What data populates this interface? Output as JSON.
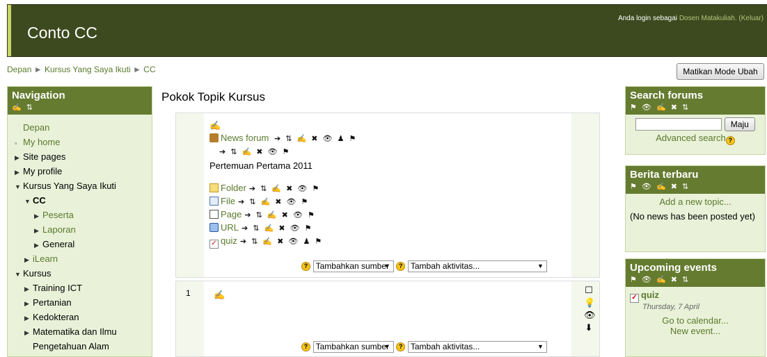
{
  "header": {
    "site_title": "Conto CC",
    "login_prefix": "Anda login sebagai",
    "login_user": "Dosen Matakuliah.",
    "logout_label": "(Keluar)"
  },
  "breadcrumb": {
    "items": [
      "Depan",
      "Kursus Yang Saya Ikuti",
      "CC"
    ],
    "separator": "►"
  },
  "edit_mode_button": "Matikan Mode Ubah",
  "navigation": {
    "title": "Navigation",
    "items": [
      {
        "label": "Depan",
        "marker": ""
      },
      {
        "label": "My home",
        "marker": "▫"
      },
      {
        "label": "Site pages",
        "marker": "▶"
      },
      {
        "label": "My profile",
        "marker": "▶"
      },
      {
        "label": "Kursus Yang Saya Ikuti",
        "marker": "▼"
      },
      {
        "label": "CC",
        "marker": "▼"
      },
      {
        "label": "Peserta",
        "marker": "▶"
      },
      {
        "label": "Laporan",
        "marker": "▶"
      },
      {
        "label": "General",
        "marker": "▶"
      },
      {
        "label": "iLearn",
        "marker": "▶"
      },
      {
        "label": "Kursus",
        "marker": "▼"
      },
      {
        "label": "Training ICT",
        "marker": "▶"
      },
      {
        "label": "Pertanian",
        "marker": "▶"
      },
      {
        "label": "Kedokteran",
        "marker": "▶"
      },
      {
        "label": "Matematika dan Ilmu",
        "marker": "▶"
      },
      {
        "label": "Pengetahuan Alam",
        "marker": ""
      }
    ]
  },
  "main": {
    "heading": "Pokok Topik Kursus",
    "section0": {
      "news_forum": "News forum",
      "summary": "Pertemuan Pertama 2011",
      "activities": [
        {
          "name": "Folder",
          "icon": "folder-icon"
        },
        {
          "name": "File",
          "icon": "file-icon"
        },
        {
          "name": "Page",
          "icon": "page-icon"
        },
        {
          "name": "URL",
          "icon": "url-icon"
        },
        {
          "name": "quiz",
          "icon": "quiz-icon"
        }
      ]
    },
    "section1": {
      "number": "1"
    },
    "add_resource": "Tambahkan sumber",
    "add_activity": "Tambah aktivitas..."
  },
  "search_forums": {
    "title": "Search forums",
    "go_label": "Maju",
    "advanced_search": "Advanced search"
  },
  "latest_news": {
    "title": "Berita terbaru",
    "add_topic": "Add a new topic...",
    "empty_text": "(No news has been posted yet)"
  },
  "upcoming_events": {
    "title": "Upcoming events",
    "event_name": "quiz",
    "event_date": "Thursday, 7 April",
    "go_calendar": "Go to calendar...",
    "new_event": "New event..."
  }
}
